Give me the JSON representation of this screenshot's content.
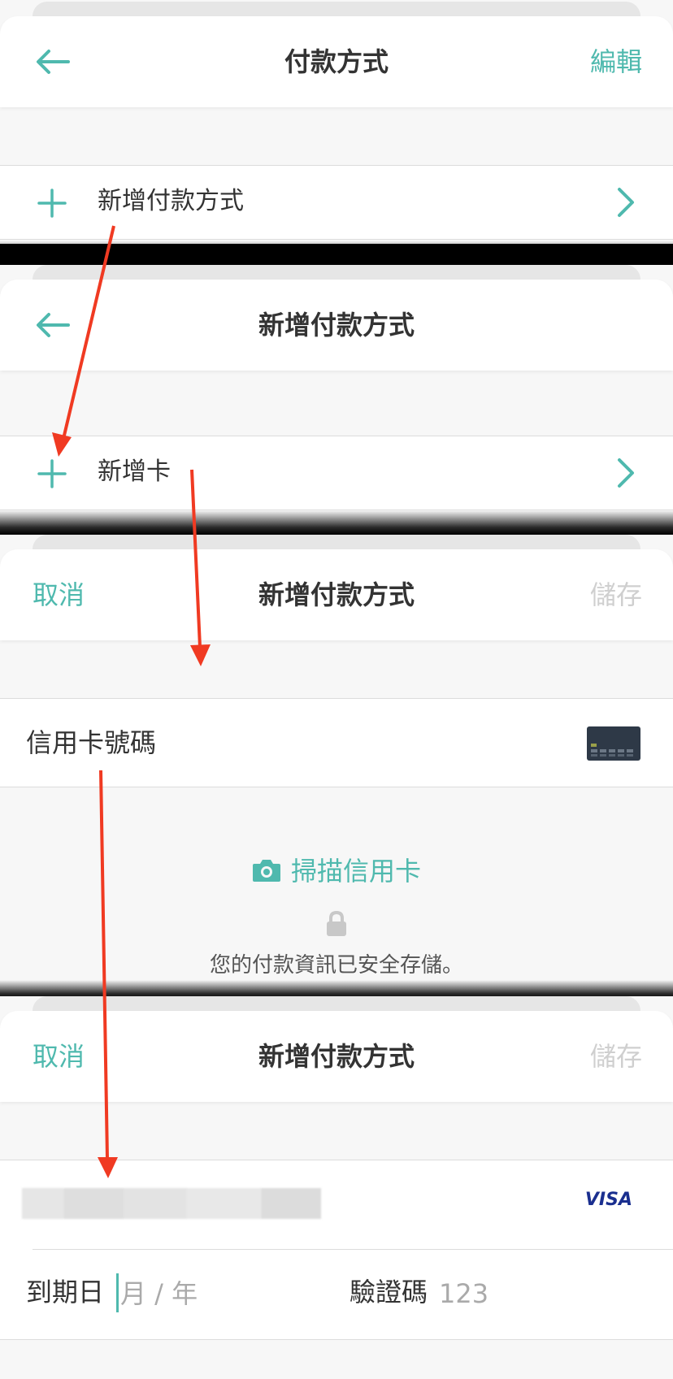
{
  "screen1": {
    "title": "付款方式",
    "edit_label": "編輯",
    "add_row_label": "新增付款方式"
  },
  "screen2": {
    "title": "新增付款方式",
    "add_card_label": "新增卡"
  },
  "screen3": {
    "cancel_label": "取消",
    "title": "新增付款方式",
    "save_label": "儲存",
    "card_number_label": "信用卡號碼",
    "scan_label": "掃描信用卡",
    "secure_text": "您的付款資訊已安全存儲。"
  },
  "screen4": {
    "cancel_label": "取消",
    "title": "新增付款方式",
    "save_label": "儲存",
    "card_brand": "VISA",
    "expiry_label": "到期日",
    "expiry_placeholder": "月 / 年",
    "cvc_label": "驗證碼",
    "cvc_placeholder": "123"
  },
  "colors": {
    "accent": "#4fb9ae",
    "disabled": "#cfcfcf",
    "annotation_arrow": "#f03a22"
  }
}
